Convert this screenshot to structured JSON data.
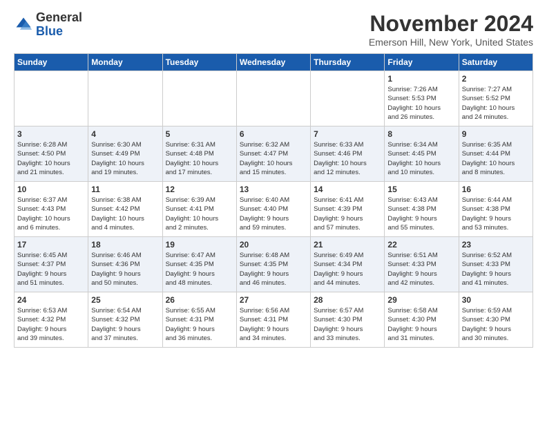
{
  "logo": {
    "general": "General",
    "blue": "Blue"
  },
  "title": "November 2024",
  "location": "Emerson Hill, New York, United States",
  "weekdays": [
    "Sunday",
    "Monday",
    "Tuesday",
    "Wednesday",
    "Thursday",
    "Friday",
    "Saturday"
  ],
  "weeks": [
    [
      {
        "day": "",
        "info": ""
      },
      {
        "day": "",
        "info": ""
      },
      {
        "day": "",
        "info": ""
      },
      {
        "day": "",
        "info": ""
      },
      {
        "day": "",
        "info": ""
      },
      {
        "day": "1",
        "info": "Sunrise: 7:26 AM\nSunset: 5:53 PM\nDaylight: 10 hours\nand 26 minutes."
      },
      {
        "day": "2",
        "info": "Sunrise: 7:27 AM\nSunset: 5:52 PM\nDaylight: 10 hours\nand 24 minutes."
      }
    ],
    [
      {
        "day": "3",
        "info": "Sunrise: 6:28 AM\nSunset: 4:50 PM\nDaylight: 10 hours\nand 21 minutes."
      },
      {
        "day": "4",
        "info": "Sunrise: 6:30 AM\nSunset: 4:49 PM\nDaylight: 10 hours\nand 19 minutes."
      },
      {
        "day": "5",
        "info": "Sunrise: 6:31 AM\nSunset: 4:48 PM\nDaylight: 10 hours\nand 17 minutes."
      },
      {
        "day": "6",
        "info": "Sunrise: 6:32 AM\nSunset: 4:47 PM\nDaylight: 10 hours\nand 15 minutes."
      },
      {
        "day": "7",
        "info": "Sunrise: 6:33 AM\nSunset: 4:46 PM\nDaylight: 10 hours\nand 12 minutes."
      },
      {
        "day": "8",
        "info": "Sunrise: 6:34 AM\nSunset: 4:45 PM\nDaylight: 10 hours\nand 10 minutes."
      },
      {
        "day": "9",
        "info": "Sunrise: 6:35 AM\nSunset: 4:44 PM\nDaylight: 10 hours\nand 8 minutes."
      }
    ],
    [
      {
        "day": "10",
        "info": "Sunrise: 6:37 AM\nSunset: 4:43 PM\nDaylight: 10 hours\nand 6 minutes."
      },
      {
        "day": "11",
        "info": "Sunrise: 6:38 AM\nSunset: 4:42 PM\nDaylight: 10 hours\nand 4 minutes."
      },
      {
        "day": "12",
        "info": "Sunrise: 6:39 AM\nSunset: 4:41 PM\nDaylight: 10 hours\nand 2 minutes."
      },
      {
        "day": "13",
        "info": "Sunrise: 6:40 AM\nSunset: 4:40 PM\nDaylight: 9 hours\nand 59 minutes."
      },
      {
        "day": "14",
        "info": "Sunrise: 6:41 AM\nSunset: 4:39 PM\nDaylight: 9 hours\nand 57 minutes."
      },
      {
        "day": "15",
        "info": "Sunrise: 6:43 AM\nSunset: 4:38 PM\nDaylight: 9 hours\nand 55 minutes."
      },
      {
        "day": "16",
        "info": "Sunrise: 6:44 AM\nSunset: 4:38 PM\nDaylight: 9 hours\nand 53 minutes."
      }
    ],
    [
      {
        "day": "17",
        "info": "Sunrise: 6:45 AM\nSunset: 4:37 PM\nDaylight: 9 hours\nand 51 minutes."
      },
      {
        "day": "18",
        "info": "Sunrise: 6:46 AM\nSunset: 4:36 PM\nDaylight: 9 hours\nand 50 minutes."
      },
      {
        "day": "19",
        "info": "Sunrise: 6:47 AM\nSunset: 4:35 PM\nDaylight: 9 hours\nand 48 minutes."
      },
      {
        "day": "20",
        "info": "Sunrise: 6:48 AM\nSunset: 4:35 PM\nDaylight: 9 hours\nand 46 minutes."
      },
      {
        "day": "21",
        "info": "Sunrise: 6:49 AM\nSunset: 4:34 PM\nDaylight: 9 hours\nand 44 minutes."
      },
      {
        "day": "22",
        "info": "Sunrise: 6:51 AM\nSunset: 4:33 PM\nDaylight: 9 hours\nand 42 minutes."
      },
      {
        "day": "23",
        "info": "Sunrise: 6:52 AM\nSunset: 4:33 PM\nDaylight: 9 hours\nand 41 minutes."
      }
    ],
    [
      {
        "day": "24",
        "info": "Sunrise: 6:53 AM\nSunset: 4:32 PM\nDaylight: 9 hours\nand 39 minutes."
      },
      {
        "day": "25",
        "info": "Sunrise: 6:54 AM\nSunset: 4:32 PM\nDaylight: 9 hours\nand 37 minutes."
      },
      {
        "day": "26",
        "info": "Sunrise: 6:55 AM\nSunset: 4:31 PM\nDaylight: 9 hours\nand 36 minutes."
      },
      {
        "day": "27",
        "info": "Sunrise: 6:56 AM\nSunset: 4:31 PM\nDaylight: 9 hours\nand 34 minutes."
      },
      {
        "day": "28",
        "info": "Sunrise: 6:57 AM\nSunset: 4:30 PM\nDaylight: 9 hours\nand 33 minutes."
      },
      {
        "day": "29",
        "info": "Sunrise: 6:58 AM\nSunset: 4:30 PM\nDaylight: 9 hours\nand 31 minutes."
      },
      {
        "day": "30",
        "info": "Sunrise: 6:59 AM\nSunset: 4:30 PM\nDaylight: 9 hours\nand 30 minutes."
      }
    ]
  ]
}
